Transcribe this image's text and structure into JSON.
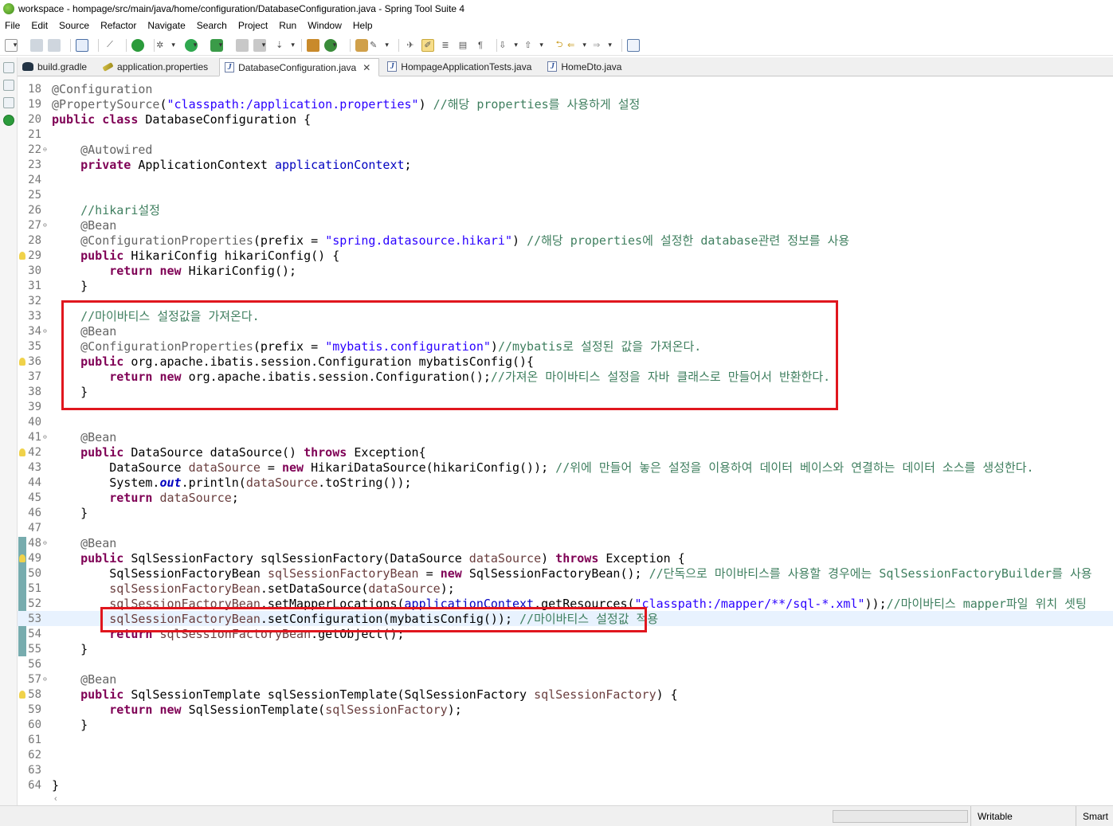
{
  "window": {
    "title": "workspace - hompage/src/main/java/home/configuration/DatabaseConfiguration.java - Spring Tool Suite 4"
  },
  "menu": [
    "File",
    "Edit",
    "Source",
    "Refactor",
    "Navigate",
    "Search",
    "Project",
    "Run",
    "Window",
    "Help"
  ],
  "tabs": [
    {
      "label": "build.gradle",
      "icon": "gradle-icon",
      "active": false
    },
    {
      "label": "application.properties",
      "icon": "properties-icon",
      "active": false
    },
    {
      "label": "DatabaseConfiguration.java",
      "icon": "java-file-icon",
      "active": true,
      "close": "✕"
    },
    {
      "label": "HompageApplicationTests.java",
      "icon": "java-file-icon",
      "active": false
    },
    {
      "label": "HomeDto.java",
      "icon": "java-file-icon",
      "active": false
    }
  ],
  "editor": {
    "lines": [
      {
        "n": "18",
        "fold": "",
        "warn": false,
        "segs": [
          [
            "ann",
            "@Configuration"
          ]
        ]
      },
      {
        "n": "19",
        "fold": "",
        "warn": false,
        "segs": [
          [
            "ann",
            "@PropertySource"
          ],
          [
            "plain",
            "("
          ],
          [
            "str",
            "\"classpath:/application.properties\""
          ],
          [
            "plain",
            ") "
          ],
          [
            "cmt",
            "//해당 properties를 사용하게 설정"
          ]
        ]
      },
      {
        "n": "20",
        "fold": "",
        "warn": false,
        "segs": [
          [
            "kw",
            "public class "
          ],
          [
            "plain",
            "DatabaseConfiguration {"
          ]
        ]
      },
      {
        "n": "21",
        "fold": "",
        "warn": false,
        "segs": []
      },
      {
        "n": "22",
        "fold": "⊖",
        "warn": false,
        "segs": [
          [
            "plain",
            "    "
          ],
          [
            "ann",
            "@Autowired"
          ]
        ]
      },
      {
        "n": "23",
        "fold": "",
        "warn": false,
        "segs": [
          [
            "plain",
            "    "
          ],
          [
            "kw",
            "private "
          ],
          [
            "plain",
            "ApplicationContext "
          ],
          [
            "fld",
            "applicationContext"
          ],
          [
            "plain",
            ";"
          ]
        ]
      },
      {
        "n": "24",
        "fold": "",
        "warn": false,
        "segs": []
      },
      {
        "n": "25",
        "fold": "",
        "warn": false,
        "segs": []
      },
      {
        "n": "26",
        "fold": "",
        "warn": false,
        "segs": [
          [
            "plain",
            "    "
          ],
          [
            "cmt",
            "//hikari설정"
          ]
        ]
      },
      {
        "n": "27",
        "fold": "⊖",
        "warn": false,
        "segs": [
          [
            "plain",
            "    "
          ],
          [
            "ann",
            "@Bean"
          ]
        ]
      },
      {
        "n": "28",
        "fold": "",
        "warn": false,
        "segs": [
          [
            "plain",
            "    "
          ],
          [
            "ann",
            "@ConfigurationProperties"
          ],
          [
            "plain",
            "(prefix = "
          ],
          [
            "str",
            "\"spring.datasource.hikari\""
          ],
          [
            "plain",
            ") "
          ],
          [
            "cmt",
            "//해당 properties에 설정한 database관련 정보를 사용"
          ]
        ]
      },
      {
        "n": "29",
        "fold": "",
        "warn": true,
        "segs": [
          [
            "plain",
            "    "
          ],
          [
            "kw",
            "public "
          ],
          [
            "plain",
            "HikariConfig hikariConfig() {"
          ]
        ]
      },
      {
        "n": "30",
        "fold": "",
        "warn": false,
        "segs": [
          [
            "plain",
            "        "
          ],
          [
            "kw",
            "return new "
          ],
          [
            "plain",
            "HikariConfig();"
          ]
        ]
      },
      {
        "n": "31",
        "fold": "",
        "warn": false,
        "segs": [
          [
            "plain",
            "    }"
          ]
        ]
      },
      {
        "n": "32",
        "fold": "",
        "warn": false,
        "segs": []
      },
      {
        "n": "33",
        "fold": "",
        "warn": false,
        "segs": [
          [
            "plain",
            "    "
          ],
          [
            "cmt",
            "//마이바티스 설정값을 가져온다."
          ]
        ]
      },
      {
        "n": "34",
        "fold": "⊖",
        "warn": false,
        "segs": [
          [
            "plain",
            "    "
          ],
          [
            "ann",
            "@Bean"
          ]
        ]
      },
      {
        "n": "35",
        "fold": "",
        "warn": false,
        "segs": [
          [
            "plain",
            "    "
          ],
          [
            "ann",
            "@ConfigurationProperties"
          ],
          [
            "plain",
            "(prefix = "
          ],
          [
            "str",
            "\"mybatis.configuration\""
          ],
          [
            "plain",
            ")"
          ],
          [
            "cmt",
            "//mybatis로 설정된 값을 가져온다."
          ]
        ]
      },
      {
        "n": "36",
        "fold": "",
        "warn": true,
        "segs": [
          [
            "plain",
            "    "
          ],
          [
            "kw",
            "public "
          ],
          [
            "plain",
            "org.apache.ibatis.session.Configuration mybatisConfig(){"
          ]
        ]
      },
      {
        "n": "37",
        "fold": "",
        "warn": false,
        "segs": [
          [
            "plain",
            "        "
          ],
          [
            "kw",
            "return new "
          ],
          [
            "plain",
            "org.apache.ibatis.session.Configuration();"
          ],
          [
            "cmt",
            "//가져온 마이바티스 설정을 자바 클래스로 만들어서 반환한다."
          ]
        ]
      },
      {
        "n": "38",
        "fold": "",
        "warn": false,
        "segs": [
          [
            "plain",
            "    }"
          ]
        ]
      },
      {
        "n": "39",
        "fold": "",
        "warn": false,
        "segs": []
      },
      {
        "n": "40",
        "fold": "",
        "warn": false,
        "segs": []
      },
      {
        "n": "41",
        "fold": "⊖",
        "warn": false,
        "segs": [
          [
            "plain",
            "    "
          ],
          [
            "ann",
            "@Bean"
          ]
        ]
      },
      {
        "n": "42",
        "fold": "",
        "warn": true,
        "segs": [
          [
            "plain",
            "    "
          ],
          [
            "kw",
            "public "
          ],
          [
            "plain",
            "DataSource dataSource() "
          ],
          [
            "kw",
            "throws "
          ],
          [
            "plain",
            "Exception{"
          ]
        ]
      },
      {
        "n": "43",
        "fold": "",
        "warn": false,
        "segs": [
          [
            "plain",
            "        DataSource "
          ],
          [
            "prm",
            "dataSource"
          ],
          [
            "plain",
            " = "
          ],
          [
            "kw",
            "new "
          ],
          [
            "plain",
            "HikariDataSource(hikariConfig()); "
          ],
          [
            "cmt",
            "//위에 만들어 놓은 설정을 이용하여 데이터 베이스와 연결하는 데이터 소스를 생성한다."
          ]
        ]
      },
      {
        "n": "44",
        "fold": "",
        "warn": false,
        "segs": [
          [
            "plain",
            "        System."
          ],
          [
            "sfld",
            "out"
          ],
          [
            "plain",
            ".println("
          ],
          [
            "prm",
            "dataSource"
          ],
          [
            "plain",
            ".toString());"
          ]
        ]
      },
      {
        "n": "45",
        "fold": "",
        "warn": false,
        "segs": [
          [
            "plain",
            "        "
          ],
          [
            "kw",
            "return "
          ],
          [
            "prm",
            "dataSource"
          ],
          [
            "plain",
            ";"
          ]
        ]
      },
      {
        "n": "46",
        "fold": "",
        "warn": false,
        "segs": [
          [
            "plain",
            "    }"
          ]
        ]
      },
      {
        "n": "47",
        "fold": "",
        "warn": false,
        "segs": []
      },
      {
        "n": "48",
        "fold": "⊖",
        "warn": false,
        "segs": [
          [
            "plain",
            "    "
          ],
          [
            "ann",
            "@Bean"
          ]
        ]
      },
      {
        "n": "49",
        "fold": "",
        "warn": true,
        "segs": [
          [
            "plain",
            "    "
          ],
          [
            "kw",
            "public "
          ],
          [
            "plain",
            "SqlSessionFactory sqlSessionFactory(DataSource "
          ],
          [
            "prm",
            "dataSource"
          ],
          [
            "plain",
            ") "
          ],
          [
            "kw",
            "throws "
          ],
          [
            "plain",
            "Exception {"
          ]
        ]
      },
      {
        "n": "50",
        "fold": "",
        "warn": false,
        "segs": [
          [
            "plain",
            "        SqlSessionFactoryBean "
          ],
          [
            "prm",
            "sqlSessionFactoryBean"
          ],
          [
            "plain",
            " = "
          ],
          [
            "kw",
            "new "
          ],
          [
            "plain",
            "SqlSessionFactoryBean(); "
          ],
          [
            "cmt",
            "//단독으로 마이바티스를 사용할 경우에는 SqlSessionFactoryBuilder를 사용"
          ]
        ]
      },
      {
        "n": "51",
        "fold": "",
        "warn": false,
        "segs": [
          [
            "plain",
            "        "
          ],
          [
            "prm",
            "sqlSessionFactoryBean"
          ],
          [
            "plain",
            ".setDataSource("
          ],
          [
            "prm",
            "dataSource"
          ],
          [
            "plain",
            ");"
          ]
        ]
      },
      {
        "n": "52",
        "fold": "",
        "warn": false,
        "segs": [
          [
            "plain",
            "        "
          ],
          [
            "prm",
            "sqlSessionFactoryBean"
          ],
          [
            "plain",
            ".setMapperLocations("
          ],
          [
            "fld",
            "applicationContext"
          ],
          [
            "plain",
            ".getResources("
          ],
          [
            "str",
            "\"classpath:/mapper/**/sql-*.xml\""
          ],
          [
            "plain",
            "));"
          ],
          [
            "cmt",
            "//마이바티스 mapper파일 위치 셋팅"
          ]
        ]
      },
      {
        "n": "53",
        "fold": "",
        "warn": false,
        "current": true,
        "segs": [
          [
            "plain",
            "        "
          ],
          [
            "prm",
            "sqlSessionFactoryBean"
          ],
          [
            "plain",
            ".setConfiguration(mybatisConfig()); "
          ],
          [
            "cmt",
            "//마이바티스 설정값 적용"
          ]
        ]
      },
      {
        "n": "54",
        "fold": "",
        "warn": false,
        "segs": [
          [
            "plain",
            "        "
          ],
          [
            "kw",
            "return "
          ],
          [
            "prm",
            "sqlSessionFactoryBean"
          ],
          [
            "plain",
            ".getObject();"
          ]
        ]
      },
      {
        "n": "55",
        "fold": "",
        "warn": false,
        "segs": [
          [
            "plain",
            "    }"
          ]
        ]
      },
      {
        "n": "56",
        "fold": "",
        "warn": false,
        "segs": []
      },
      {
        "n": "57",
        "fold": "⊖",
        "warn": false,
        "segs": [
          [
            "plain",
            "    "
          ],
          [
            "ann",
            "@Bean"
          ]
        ]
      },
      {
        "n": "58",
        "fold": "",
        "warn": true,
        "segs": [
          [
            "plain",
            "    "
          ],
          [
            "kw",
            "public "
          ],
          [
            "plain",
            "SqlSessionTemplate sqlSessionTemplate(SqlSessionFactory "
          ],
          [
            "prm",
            "sqlSessionFactory"
          ],
          [
            "plain",
            ") {"
          ]
        ]
      },
      {
        "n": "59",
        "fold": "",
        "warn": false,
        "segs": [
          [
            "plain",
            "        "
          ],
          [
            "kw",
            "return new "
          ],
          [
            "plain",
            "SqlSessionTemplate("
          ],
          [
            "prm",
            "sqlSessionFactory"
          ],
          [
            "plain",
            ");"
          ]
        ]
      },
      {
        "n": "60",
        "fold": "",
        "warn": false,
        "segs": [
          [
            "plain",
            "    }"
          ]
        ]
      },
      {
        "n": "61",
        "fold": "",
        "warn": false,
        "segs": []
      },
      {
        "n": "62",
        "fold": "",
        "warn": false,
        "segs": []
      },
      {
        "n": "63",
        "fold": "",
        "warn": false,
        "segs": []
      },
      {
        "n": "64",
        "fold": "",
        "warn": false,
        "segs": [
          [
            "plain",
            "}"
          ]
        ]
      }
    ]
  },
  "status": {
    "writable": "Writable",
    "insert_mode": "Smart"
  },
  "colors": {
    "keyword": "#7f0055",
    "annotation": "#646464",
    "string": "#2a00ff",
    "comment": "#3f7f5f",
    "highlight_box": "#e0161e"
  }
}
